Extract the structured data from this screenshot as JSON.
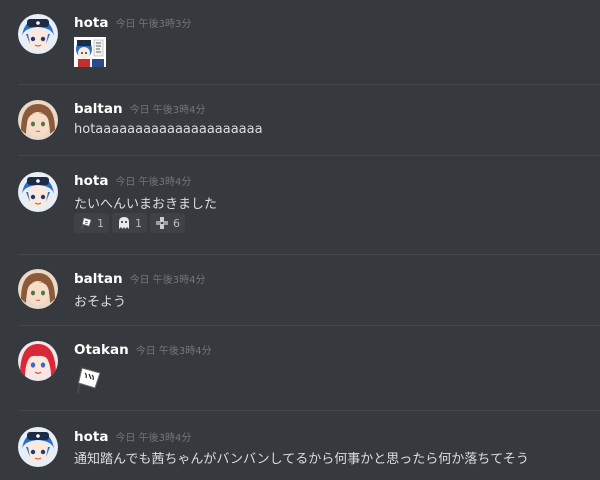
{
  "messages": [
    {
      "author": "hota",
      "timestamp": "今日 午後3時3分",
      "avatar": "hota-avatar",
      "attachment": "sticker-thumbnail",
      "text": ""
    },
    {
      "author": "baltan",
      "timestamp": "今日 午後3時4分",
      "avatar": "baltan-avatar",
      "text": "hotaaaaaaaaaaaaaaaaaaaaa"
    },
    {
      "author": "hota",
      "timestamp": "今日 午後3時4分",
      "avatar": "hota-avatar",
      "text": "たいへんいまおきました",
      "reactions": [
        {
          "emoji": "flag-emoji",
          "count": "1"
        },
        {
          "emoji": "ghost-emoji",
          "count": "1"
        },
        {
          "emoji": "puzzle-emoji",
          "count": "6"
        }
      ]
    },
    {
      "author": "baltan",
      "timestamp": "今日 午後3時4分",
      "avatar": "baltan-avatar",
      "text": "おそよう"
    },
    {
      "author": "Otakan",
      "timestamp": "今日 午後3時4分",
      "avatar": "otakan-avatar",
      "attachment": "flag-sticker",
      "text": ""
    },
    {
      "author": "hota",
      "timestamp": "今日 午後3時4分",
      "avatar": "hota-avatar",
      "text": "通知踏んでも茜ちゃんがバンバンしてるから何事かと思ったら何か落ちてそう"
    }
  ],
  "colors": {
    "background": "#36393e",
    "username": "#ffffff",
    "timestamp": "#72767d",
    "text": "#dcddde",
    "divider": "#43464c",
    "reaction_bg": "#3e4147"
  }
}
